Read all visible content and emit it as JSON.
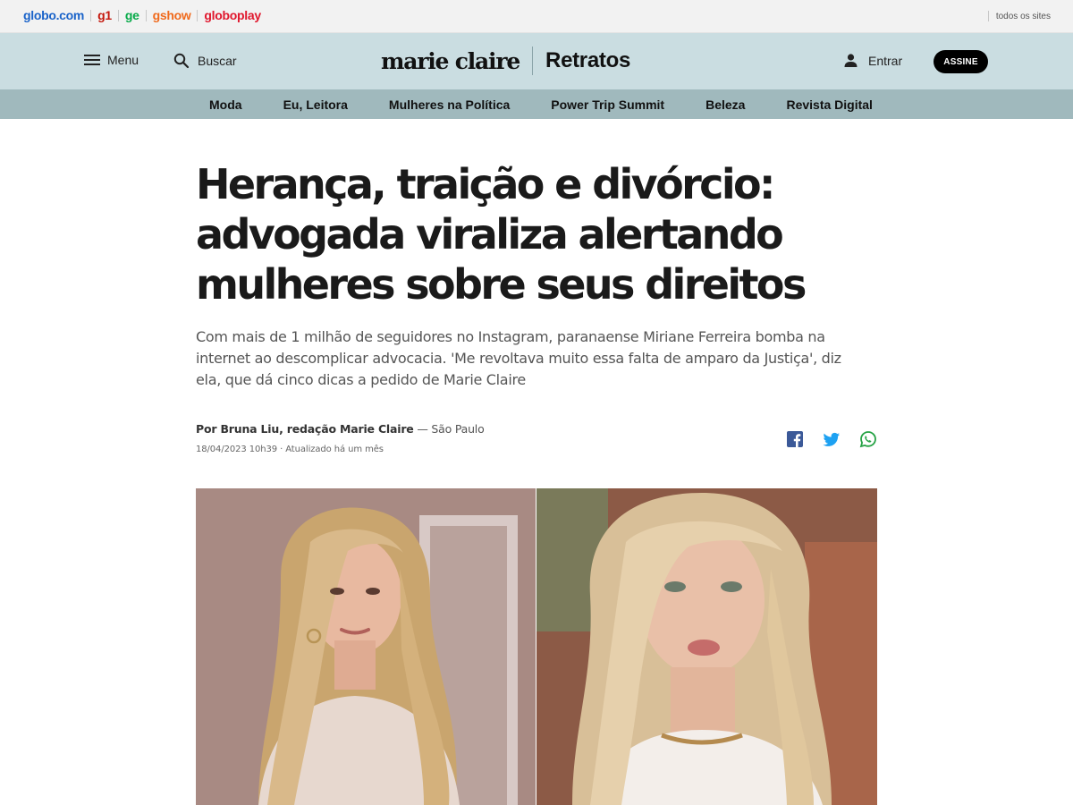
{
  "globo_bar": {
    "links": [
      "globo.com",
      "g1",
      "ge",
      "gshow",
      "globoplay"
    ],
    "all_sites": "todos os sites"
  },
  "header": {
    "menu_label": "Menu",
    "search_label": "Buscar",
    "brand": "marie claire",
    "section": "Retratos",
    "login_label": "Entrar",
    "subscribe_label": "ASSINE"
  },
  "nav": {
    "items": [
      "Moda",
      "Eu, Leitora",
      "Mulheres na Política",
      "Power Trip Summit",
      "Beleza",
      "Revista Digital"
    ]
  },
  "article": {
    "headline": "Herança, traição e divórcio: advogada viraliza alertando mulheres sobre seus direitos",
    "subtitle": "Com mais de 1 milhão de seguidores no Instagram, paranaense Miriane Ferreira bomba na internet ao descomplicar advocacia. 'Me revoltava muito essa falta de amparo da Justiça', diz ela, que dá cinco dicas a pedido de Marie Claire",
    "author": "Por Bruna Liu, redação Marie Claire",
    "location": " — São Paulo",
    "date": "18/04/2023 10h39 · Atualizado há um mês"
  },
  "colors": {
    "header_bg": "#cadde1",
    "nav_bg": "#a0b9bd",
    "facebook": "#3b5998",
    "twitter": "#1da1f2",
    "whatsapp": "#25a244"
  }
}
